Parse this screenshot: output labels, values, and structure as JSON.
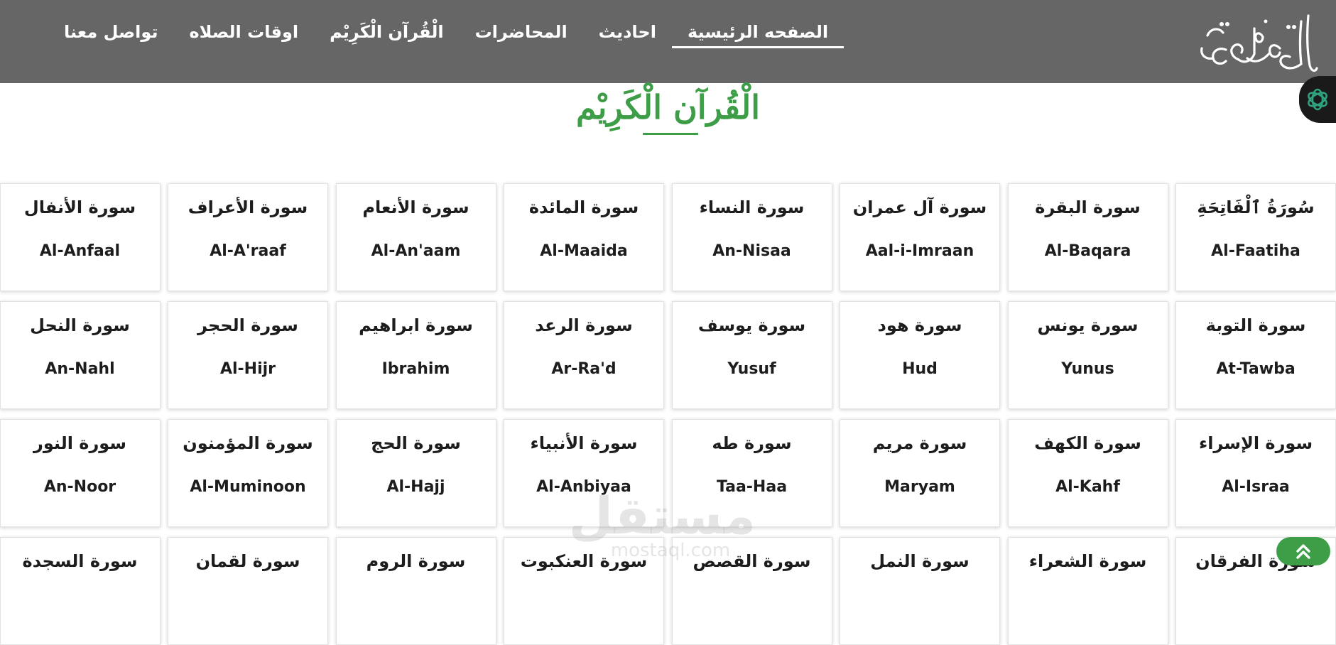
{
  "nav": {
    "items": [
      {
        "label": "الصفحه الرئيسية",
        "active": true
      },
      {
        "label": "احاديث",
        "active": false
      },
      {
        "label": "المحاضرات",
        "active": false
      },
      {
        "label": "الْقُرآن الْكَرِيْم",
        "active": false
      },
      {
        "label": "اوقات الصلاه",
        "active": false
      },
      {
        "label": "تواصل معنا",
        "active": false
      }
    ],
    "logo_text": "الموعظة"
  },
  "heading": {
    "title": "الْقُرآن الْكَرِيْم"
  },
  "surahs": [
    {
      "ar": "سُورَةُ ٱلْفَاتِحَةِ",
      "en": "Al-Faatiha"
    },
    {
      "ar": "سورة البقرة",
      "en": "Al-Baqara"
    },
    {
      "ar": "سورة آل عمران",
      "en": "Aal-i-Imraan"
    },
    {
      "ar": "سورة النساء",
      "en": "An-Nisaa"
    },
    {
      "ar": "سورة المائدة",
      "en": "Al-Maaida"
    },
    {
      "ar": "سورة الأنعام",
      "en": "Al-An'aam"
    },
    {
      "ar": "سورة الأعراف",
      "en": "Al-A'raaf"
    },
    {
      "ar": "سورة الأنفال",
      "en": "Al-Anfaal"
    },
    {
      "ar": "سورة التوبة",
      "en": "At-Tawba"
    },
    {
      "ar": "سورة يونس",
      "en": "Yunus"
    },
    {
      "ar": "سورة هود",
      "en": "Hud"
    },
    {
      "ar": "سورة يوسف",
      "en": "Yusuf"
    },
    {
      "ar": "سورة الرعد",
      "en": "Ar-Ra'd"
    },
    {
      "ar": "سورة ابراهيم",
      "en": "Ibrahim"
    },
    {
      "ar": "سورة الحجر",
      "en": "Al-Hijr"
    },
    {
      "ar": "سورة النحل",
      "en": "An-Nahl"
    },
    {
      "ar": "سورة الإسراء",
      "en": "Al-Israa"
    },
    {
      "ar": "سورة الكهف",
      "en": "Al-Kahf"
    },
    {
      "ar": "سورة مريم",
      "en": "Maryam"
    },
    {
      "ar": "سورة طه",
      "en": "Taa-Haa"
    },
    {
      "ar": "سورة الأنبياء",
      "en": "Al-Anbiyaa"
    },
    {
      "ar": "سورة الحج",
      "en": "Al-Hajj"
    },
    {
      "ar": "سورة المؤمنون",
      "en": "Al-Muminoon"
    },
    {
      "ar": "سورة النور",
      "en": "An-Noor"
    },
    {
      "ar": "سورة الفرقان",
      "en": ""
    },
    {
      "ar": "سورة الشعراء",
      "en": ""
    },
    {
      "ar": "سورة النمل",
      "en": ""
    },
    {
      "ar": "سورة القصص",
      "en": ""
    },
    {
      "ar": "سورة العنكبوت",
      "en": ""
    },
    {
      "ar": "سورة الروم",
      "en": ""
    },
    {
      "ar": "سورة لقمان",
      "en": ""
    },
    {
      "ar": "سورة السجدة",
      "en": ""
    }
  ],
  "watermark": {
    "ar": "مستقل",
    "en": "mostaql.com"
  },
  "icons": {
    "side_widget": "chatgpt-logo-icon",
    "scroll_top": "double-chevron-up-icon"
  },
  "colors": {
    "navbar": "#666666",
    "accent_green": "#3e9e48",
    "text": "#1d1d1d"
  }
}
